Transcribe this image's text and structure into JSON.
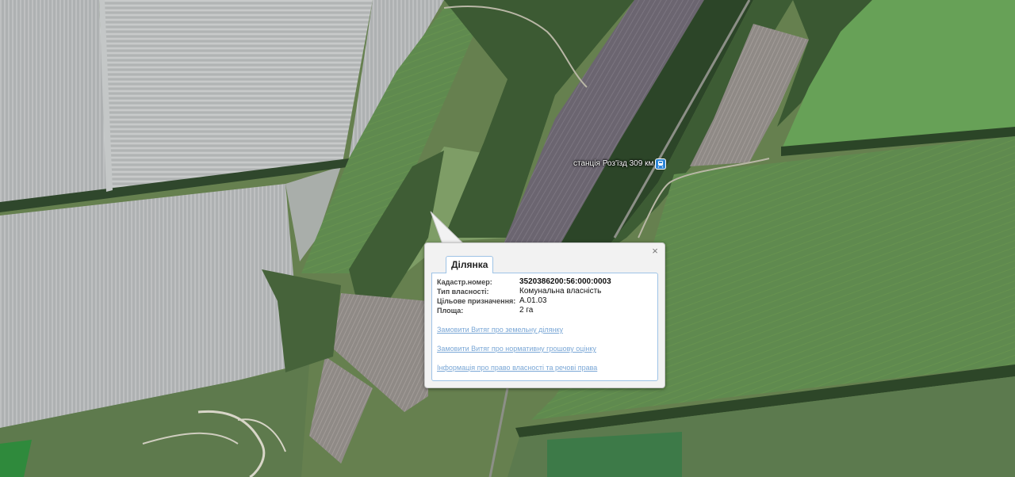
{
  "map": {
    "type": "satellite",
    "colors": {
      "field_light": "#b9bcbc",
      "field_green": "#5d8a4e",
      "field_dark": "#6d6870",
      "forest": "#2f4a2a",
      "meadow": "#7c9a62"
    }
  },
  "station": {
    "label": "станція Роз'їзд 309 км",
    "icon": "train-station-icon",
    "icon_color": "#2e86d6"
  },
  "popup": {
    "close_label": "×",
    "tab_label": "Ділянка",
    "fields": [
      {
        "label": "Кадастр.номер:",
        "value": "3520386200:56:000:0003"
      },
      {
        "label": "Тип власності:",
        "value": "Комунальна власність"
      },
      {
        "label": "Цільове призначення:",
        "value": "A.01.03"
      },
      {
        "label": "Площа:",
        "value": "2 га"
      }
    ],
    "links": [
      "Замовити Витяг про земельну ділянку",
      "Замовити Витяг про нормативну грошову оцінку",
      "Інформація про право власності та речові права"
    ],
    "link_color": "#7aa7d6",
    "border_color": "#9ec3e6"
  }
}
